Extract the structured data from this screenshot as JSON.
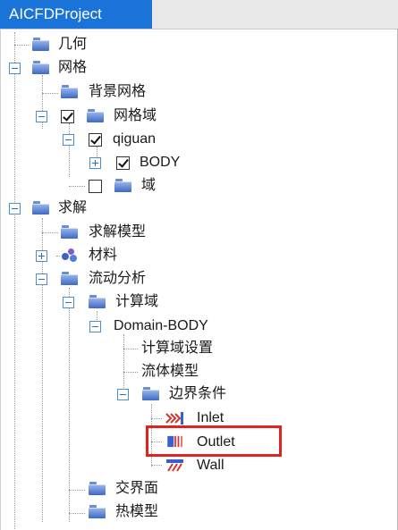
{
  "header": {
    "tab_title": "AICFDProject"
  },
  "tree": {
    "geometry": "几何",
    "mesh": "网格",
    "background_mesh": "背景网格",
    "mesh_domain": "网格域",
    "qiguan": "qiguan",
    "body": "BODY",
    "domain": "域",
    "solve": "求解",
    "solve_model": "求解模型",
    "material": "材料",
    "flow_analysis": "流动分析",
    "compute_domain": "计算域",
    "domain_body": "Domain-BODY",
    "compute_domain_settings": "计算域设置",
    "fluid_model": "流体模型",
    "boundary_conditions": "边界条件",
    "inlet": "Inlet",
    "outlet": "Outlet",
    "wall": "Wall",
    "interface": "交界面",
    "thermal_model": "热模型"
  },
  "checkbox_states": {
    "mesh_domain": true,
    "qiguan": true,
    "body": true,
    "domain": false
  },
  "selected_item": "outlet",
  "colors": {
    "tab_bg": "#1a73d9",
    "highlight_border": "#e0231e",
    "folder": "#3f68c4"
  }
}
